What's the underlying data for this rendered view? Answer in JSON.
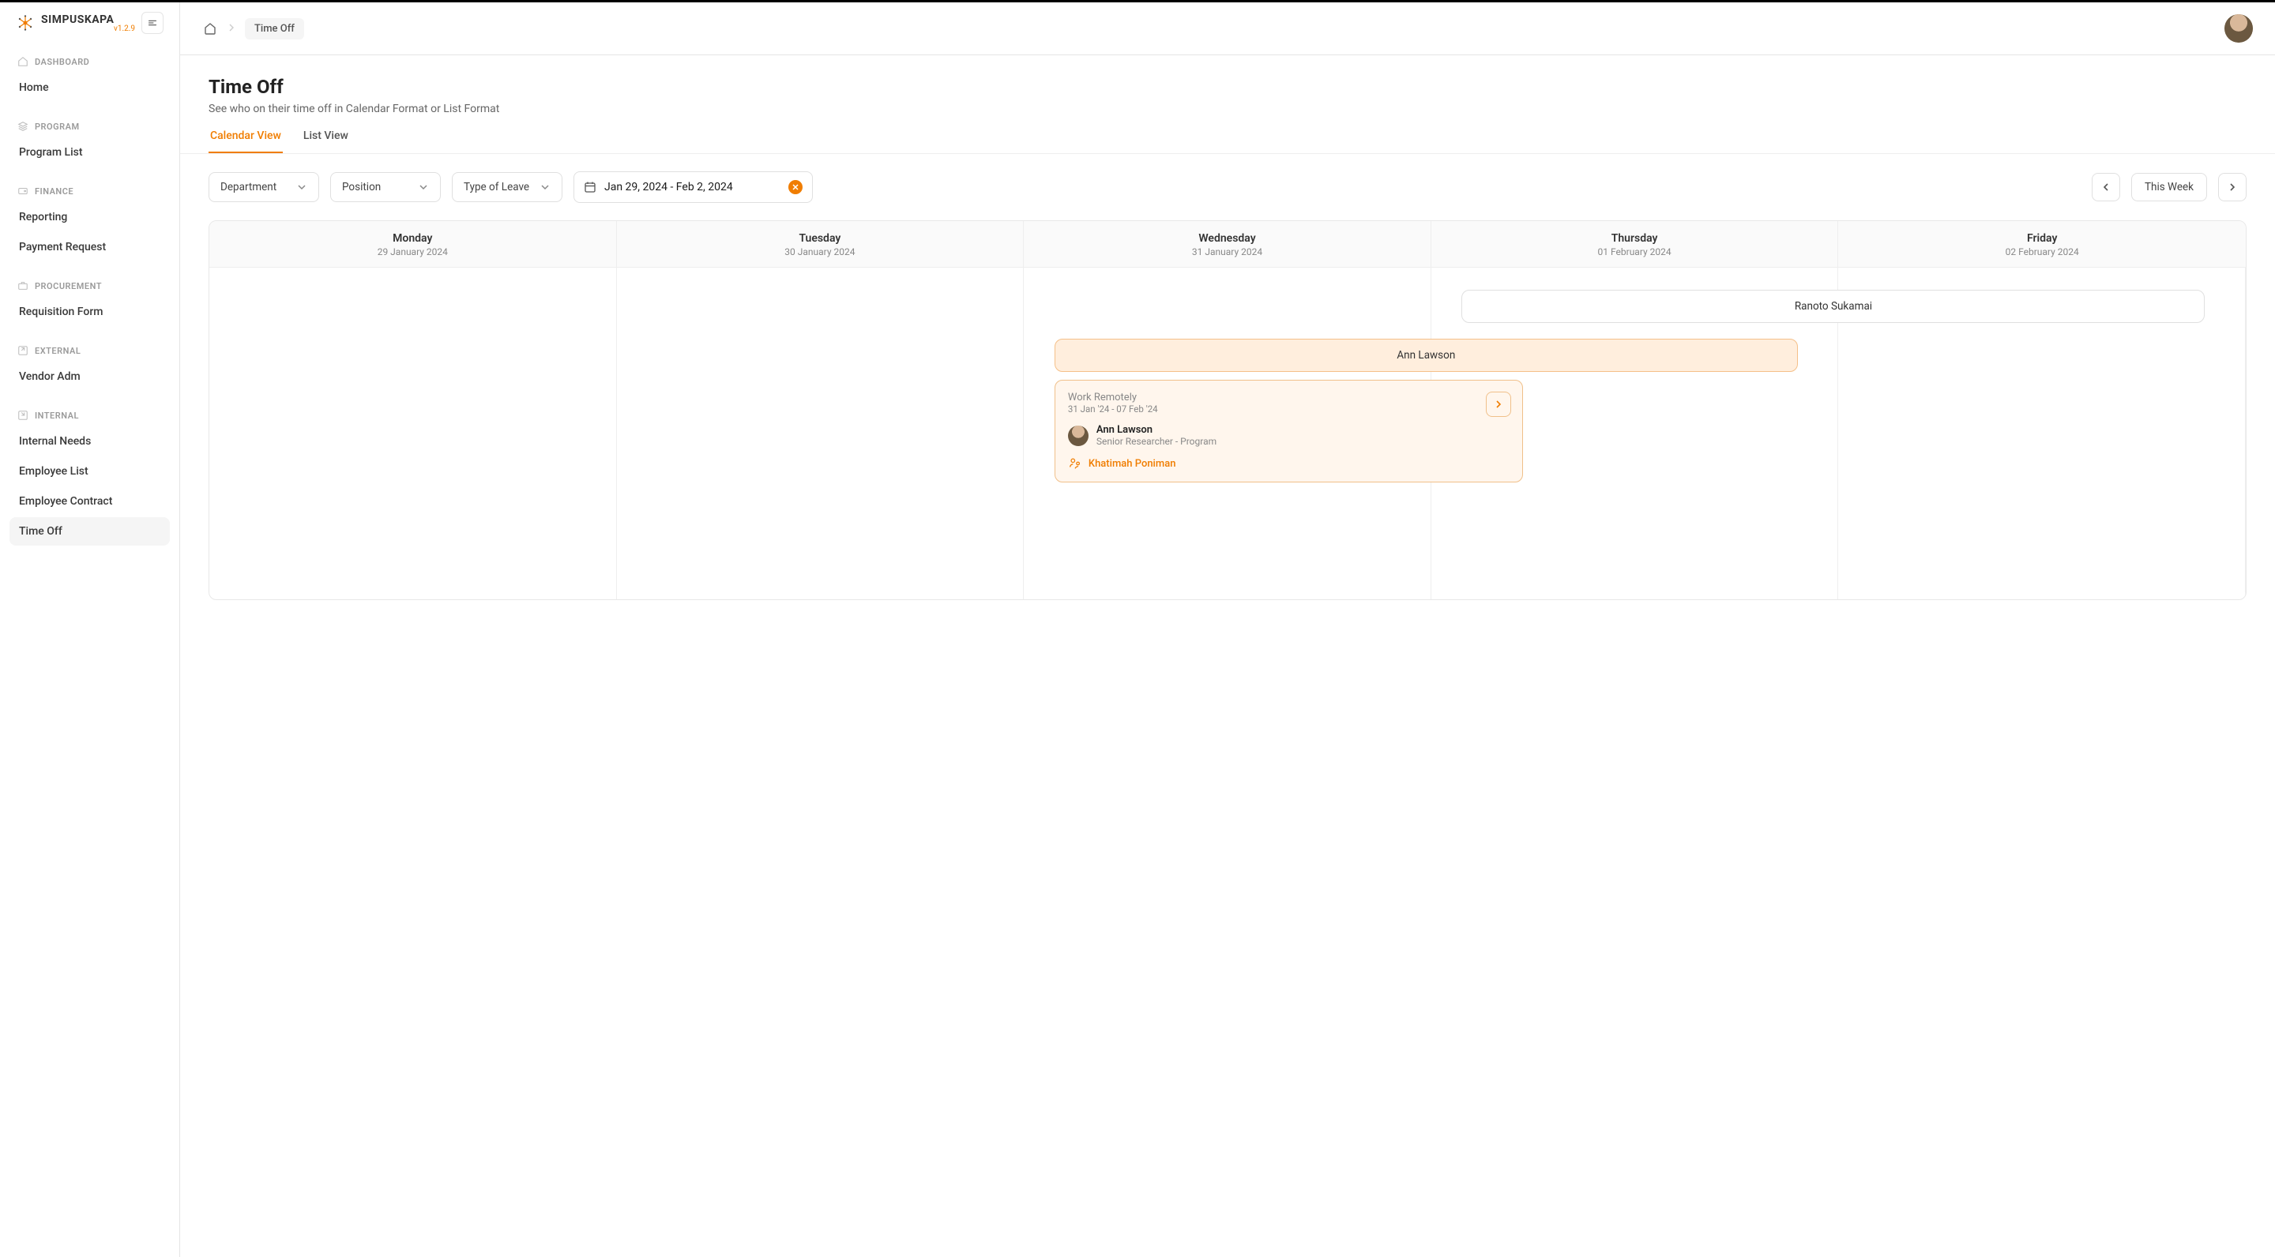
{
  "brand": {
    "name": "SIMPUSKAPA",
    "version": "v1.2.9"
  },
  "breadcrumb": {
    "current": "Time Off"
  },
  "page": {
    "title": "Time Off",
    "subtitle": "See who on their time off in Calendar Format or List Format"
  },
  "tabs": {
    "calendar": "Calendar View",
    "list": "List View"
  },
  "filters": {
    "department": "Department",
    "position": "Position",
    "leave_type": "Type of Leave",
    "date_range": "Jan 29, 2024 - Feb 2, 2024",
    "this_week": "This Week"
  },
  "days": [
    {
      "name": "Monday",
      "date": "29 January 2024"
    },
    {
      "name": "Tuesday",
      "date": "30 January 2024"
    },
    {
      "name": "Wednesday",
      "date": "31 January 2024"
    },
    {
      "name": "Thursday",
      "date": "01 February 2024"
    },
    {
      "name": "Friday",
      "date": "02 February 2024"
    }
  ],
  "events": {
    "ranoto": {
      "name": "Ranoto Sukamai"
    },
    "ann": {
      "name": "Ann Lawson"
    },
    "card": {
      "type": "Work Remotely",
      "range": "31 Jan '24 - 07 Feb '24",
      "person_name": "Ann Lawson",
      "person_role": "Senior Researcher - Program",
      "substitute": "Khatimah Poniman"
    }
  },
  "nav": {
    "dashboard": {
      "header": "DASHBOARD",
      "home": "Home"
    },
    "program": {
      "header": "PROGRAM",
      "list": "Program List"
    },
    "finance": {
      "header": "FINANCE",
      "reporting": "Reporting",
      "payment": "Payment Request"
    },
    "procurement": {
      "header": "PROCUREMENT",
      "req": "Requisition Form"
    },
    "external": {
      "header": "EXTERNAL",
      "vendor": "Vendor Adm"
    },
    "internal": {
      "header": "INTERNAL",
      "needs": "Internal Needs",
      "emplist": "Employee List",
      "contract": "Employee Contract",
      "timeoff": "Time Off"
    }
  }
}
